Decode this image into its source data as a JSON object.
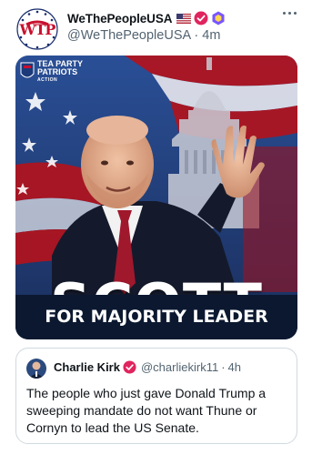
{
  "post": {
    "author": {
      "display_name": "WeThePeopleUSA",
      "handle": "@WeThePeopleUSA",
      "time": "4m",
      "avatar_text": "WTP",
      "badges": [
        "us-flag-icon",
        "verified-red-icon",
        "hexagon-purple-icon"
      ]
    },
    "media": {
      "logo_text_line1": "TEA PARTY",
      "logo_text_line2": "PATRIOTS",
      "logo_text_line3": "ACTION",
      "headline": "SCOTT",
      "subheadline": "FOR MAJORITY LEADER"
    }
  },
  "quote": {
    "display_name": "Charlie Kirk",
    "handle": "@charliekirk11",
    "time": "4h",
    "text": "The people who just gave Donald Trump a sweeping mandate do not want Thune or Cornyn to lead the US Senate."
  },
  "separator": "·",
  "colors": {
    "accent_red": "#e0245e",
    "verified_purple": "#7856ff",
    "muted": "#536471",
    "banner_navy": "#0b1830"
  }
}
